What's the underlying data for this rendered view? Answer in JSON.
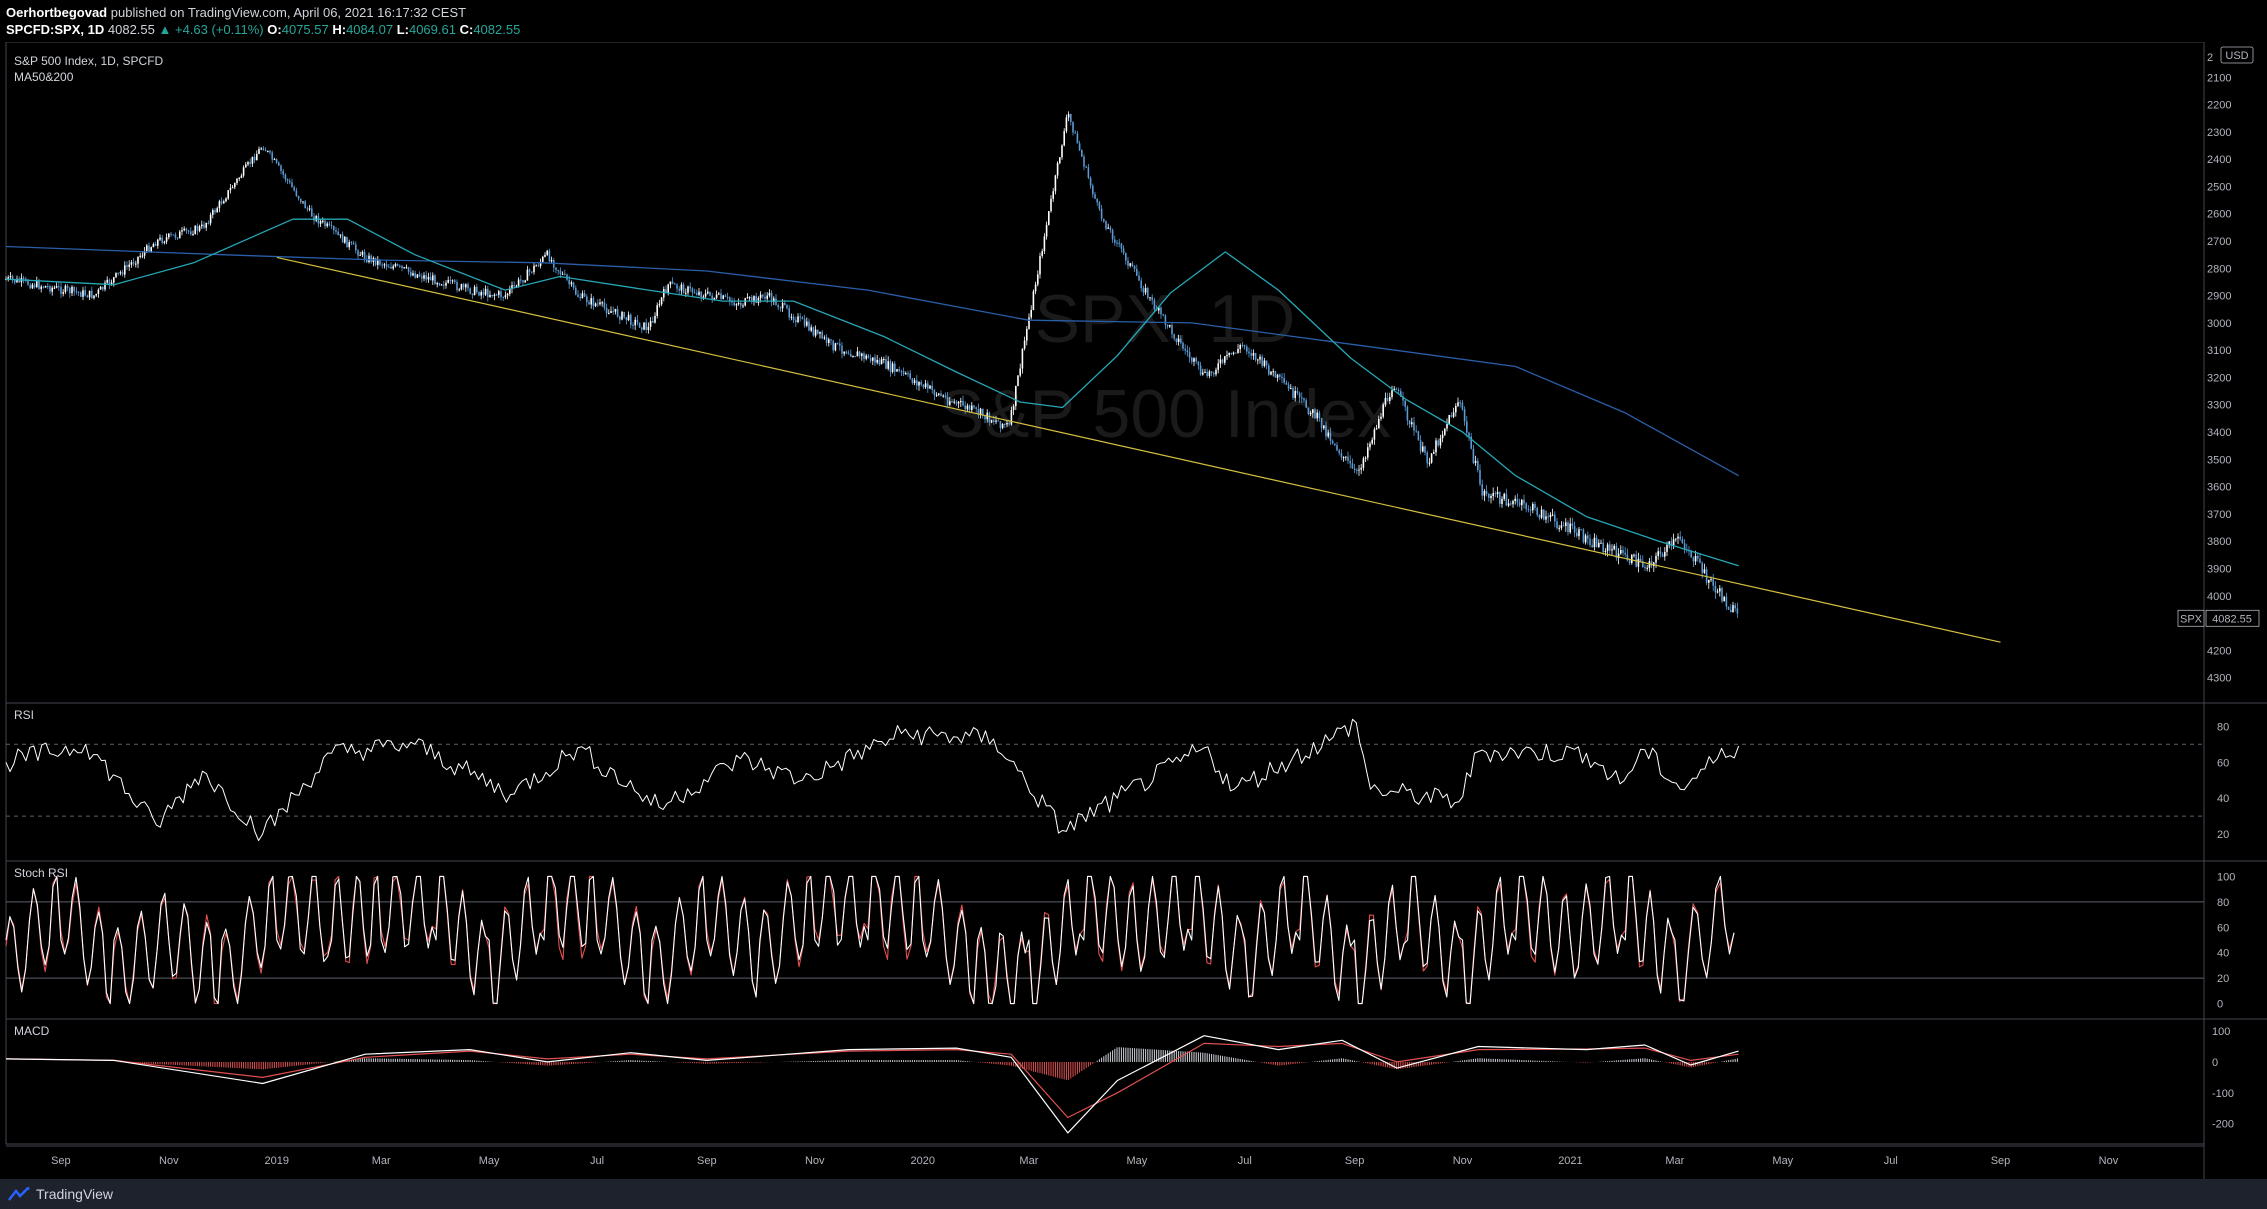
{
  "header": {
    "author": "Oerhortbegovad",
    "published_text": "published on TradingView.com, April 06, 2021 16:17:32 CEST",
    "symbol": "SPCFD:SPX, 1D",
    "last": "4082.55",
    "change": "▲ +4.63 (+0.11%)",
    "o_label": "O:",
    "o": "4075.57",
    "h_label": "H:",
    "h": "4084.07",
    "l_label": "L:",
    "l": "4069.61",
    "c_label": "C:",
    "c": "4082.55"
  },
  "footer": {
    "brand": "TradingView"
  },
  "colors": {
    "background": "#000000",
    "candle_up": "#ffffff",
    "candle_down": "#5b9bd5",
    "ma50": "#26a6b5",
    "ma200": "#2a5ea8",
    "trendline": "#d4c040",
    "rsi": "#ffffff",
    "stoch_k": "#ffffff",
    "stoch_d": "#e05050",
    "macd_line": "#ffffff",
    "signal_line": "#e05050"
  },
  "chart_data": [
    {
      "type": "candlestick",
      "title": "S&P 500 Index, 1D, SPCFD",
      "indicator_label": "MA50&200",
      "watermark_symbol": "SPX, 1D",
      "watermark_name": "S&P 500 Index",
      "currency": "USD",
      "y_axis_inverted": true,
      "ylim": [
        4360,
        2000
      ],
      "y_ticks": [
        2100,
        2200,
        2300,
        2400,
        2500,
        2600,
        2700,
        2800,
        2900,
        3000,
        3100,
        3200,
        3300,
        3400,
        3500,
        3600,
        3700,
        3800,
        3900,
        4000,
        4200,
        4300
      ],
      "y_top_label": "2",
      "price_tag_symbol": "SPX",
      "price_tag_value": "4082.55",
      "x_ticks": [
        "Sep",
        "Nov",
        "2019",
        "Mar",
        "May",
        "Jul",
        "Sep",
        "Nov",
        "2020",
        "Mar",
        "May",
        "Jul",
        "Sep",
        "Nov",
        "2021",
        "Mar",
        "May",
        "Jul",
        "Sep",
        "Nov"
      ],
      "x_tick_dates": [
        "2018-09-01",
        "2018-11-01",
        "2019-01-01",
        "2019-03-01",
        "2019-05-01",
        "2019-07-01",
        "2019-09-01",
        "2019-11-01",
        "2020-01-01",
        "2020-03-01",
        "2020-05-01",
        "2020-07-01",
        "2020-09-01",
        "2020-11-01",
        "2021-01-01",
        "2021-03-01",
        "2021-05-01",
        "2021-07-01",
        "2021-09-01",
        "2021-11-01"
      ],
      "price_path": {
        "x": [
          "2018-08-01",
          "2018-09-20",
          "2018-10-25",
          "2018-11-20",
          "2018-12-24",
          "2019-01-20",
          "2019-02-20",
          "2019-03-20",
          "2019-04-20",
          "2019-05-10",
          "2019-06-03",
          "2019-06-20",
          "2019-07-30",
          "2019-08-10",
          "2019-09-20",
          "2019-10-05",
          "2019-11-10",
          "2019-12-10",
          "2020-01-15",
          "2020-02-19",
          "2020-02-28",
          "2020-03-23",
          "2020-04-10",
          "2020-05-10",
          "2020-06-08",
          "2020-06-30",
          "2020-08-10",
          "2020-09-02",
          "2020-09-23",
          "2020-10-12",
          "2020-10-30",
          "2020-11-12",
          "2020-12-10",
          "2021-01-10",
          "2021-02-12",
          "2021-03-04",
          "2021-03-20",
          "2021-04-06"
        ],
        "y": [
          2840,
          2900,
          2700,
          2650,
          2350,
          2600,
          2760,
          2820,
          2880,
          2900,
          2750,
          2900,
          3020,
          2860,
          2930,
          2900,
          3080,
          3150,
          3280,
          3380,
          3050,
          2230,
          2600,
          2930,
          3200,
          3080,
          3340,
          3560,
          3220,
          3510,
          3280,
          3620,
          3680,
          3790,
          3890,
          3790,
          3940,
          4082.55
        ]
      },
      "ma50": {
        "x": [
          "2018-08-01",
          "2018-10-01",
          "2018-11-15",
          "2019-01-10",
          "2019-02-10",
          "2019-03-20",
          "2019-05-10",
          "2019-06-10",
          "2019-07-30",
          "2019-09-10",
          "2019-10-20",
          "2019-12-10",
          "2020-01-20",
          "2020-02-25",
          "2020-03-20",
          "2020-04-20",
          "2020-05-20",
          "2020-06-20",
          "2020-07-20",
          "2020-08-30",
          "2020-09-30",
          "2020-11-01",
          "2020-12-01",
          "2021-01-10",
          "2021-02-20",
          "2021-04-06"
        ],
        "y": [
          2840,
          2860,
          2780,
          2620,
          2620,
          2750,
          2880,
          2830,
          2880,
          2920,
          2920,
          3050,
          3180,
          3290,
          3310,
          3120,
          2890,
          2740,
          2880,
          3130,
          3280,
          3400,
          3560,
          3710,
          3800,
          3890
        ]
      },
      "ma200": {
        "x": [
          "2018-08-01",
          "2018-12-01",
          "2019-03-01",
          "2019-06-01",
          "2019-09-01",
          "2019-12-01",
          "2020-03-01",
          "2020-06-01",
          "2020-09-01",
          "2020-12-01",
          "2021-02-01",
          "2021-04-06"
        ],
        "y": [
          2720,
          2750,
          2770,
          2780,
          2810,
          2880,
          2990,
          3000,
          3080,
          3160,
          3330,
          3560
        ]
      },
      "trendline": {
        "x": [
          "2019-01-01",
          "2021-09-01"
        ],
        "y": [
          2760,
          4170
        ]
      }
    },
    {
      "type": "line",
      "title": "RSI",
      "ylim": [
        10,
        88
      ],
      "y_ticks": [
        20,
        40,
        60,
        80
      ],
      "bands": [
        30,
        70
      ],
      "x": [
        "2018-08-01",
        "2018-09-15",
        "2018-10-25",
        "2018-11-20",
        "2018-12-24",
        "2019-02-01",
        "2019-03-20",
        "2019-05-13",
        "2019-06-20",
        "2019-08-05",
        "2019-09-20",
        "2019-10-25",
        "2019-12-20",
        "2020-02-10",
        "2020-03-20",
        "2020-04-20",
        "2020-06-08",
        "2020-06-25",
        "2020-08-20",
        "2020-09-02",
        "2020-09-10",
        "2020-10-30",
        "2020-11-10",
        "2021-01-10",
        "2021-01-29",
        "2021-02-12",
        "2021-03-04",
        "2021-03-25",
        "2021-04-06"
      ],
      "y": [
        60,
        70,
        25,
        55,
        20,
        65,
        70,
        42,
        68,
        35,
        62,
        50,
        76,
        73,
        22,
        40,
        68,
        45,
        74,
        82,
        45,
        38,
        66,
        65,
        48,
        67,
        45,
        62,
        69
      ]
    },
    {
      "type": "line",
      "title": "Stoch RSI",
      "ylim": [
        -5,
        105
      ],
      "y_ticks": [
        0,
        20,
        40,
        60,
        80,
        100
      ],
      "bands": [
        20,
        80
      ],
      "x": [
        "2018-08-01",
        "2018-09-01",
        "2018-10-01",
        "2018-11-01",
        "2018-12-01",
        "2019-01-01",
        "2019-02-01",
        "2019-03-01",
        "2019-04-01",
        "2019-05-01",
        "2019-06-01",
        "2019-07-01",
        "2019-08-01",
        "2019-09-01",
        "2019-10-01",
        "2019-11-01",
        "2019-12-01",
        "2020-01-01",
        "2020-02-01",
        "2020-03-01",
        "2020-04-01",
        "2020-05-01",
        "2020-06-01",
        "2020-07-01",
        "2020-08-01",
        "2020-09-01",
        "2020-10-01",
        "2020-11-01",
        "2020-12-01",
        "2021-01-01",
        "2021-02-01",
        "2021-03-01",
        "2021-04-06"
      ],
      "k": [
        20,
        95,
        5,
        60,
        0,
        98,
        70,
        90,
        100,
        10,
        100,
        95,
        5,
        90,
        30,
        100,
        100,
        90,
        10,
        0,
        100,
        60,
        100,
        20,
        100,
        0,
        90,
        10,
        100,
        50,
        95,
        15,
        100
      ],
      "d": [
        25,
        88,
        10,
        55,
        5,
        92,
        72,
        88,
        96,
        15,
        94,
        92,
        10,
        86,
        34,
        96,
        98,
        88,
        15,
        5,
        95,
        62,
        95,
        25,
        96,
        5,
        85,
        15,
        95,
        52,
        90,
        20,
        95
      ]
    },
    {
      "type": "line",
      "title": "MACD",
      "ylim": [
        -240,
        110
      ],
      "y_ticks": [
        100,
        0,
        -100,
        -200
      ],
      "x": [
        "2018-08-01",
        "2018-10-01",
        "2018-12-24",
        "2019-02-20",
        "2019-04-20",
        "2019-06-03",
        "2019-07-20",
        "2019-09-01",
        "2019-11-20",
        "2020-01-20",
        "2020-02-20",
        "2020-03-23",
        "2020-04-20",
        "2020-06-08",
        "2020-07-20",
        "2020-08-25",
        "2020-09-25",
        "2020-11-10",
        "2021-01-10",
        "2021-02-12",
        "2021-03-10",
        "2021-04-06"
      ],
      "macd": [
        10,
        5,
        -70,
        25,
        40,
        0,
        30,
        5,
        40,
        45,
        15,
        -230,
        -60,
        85,
        40,
        70,
        -20,
        50,
        40,
        55,
        -10,
        35
      ],
      "signal": [
        10,
        5,
        -50,
        15,
        35,
        10,
        25,
        10,
        35,
        40,
        25,
        -180,
        -100,
        60,
        50,
        60,
        0,
        40,
        42,
        45,
        5,
        25
      ]
    }
  ]
}
